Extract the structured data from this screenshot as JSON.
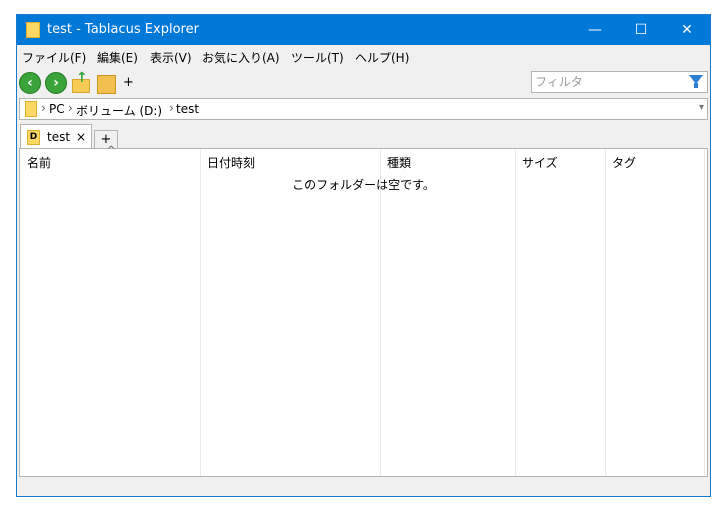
{
  "window": {
    "title": "test - Tablacus Explorer",
    "min_glyph": "—",
    "max_glyph": "☐",
    "close_glyph": "✕"
  },
  "menu": [
    "ファイル(F)",
    "編集(E)",
    "表示(V)",
    "お気に入り(A)",
    "ツール(T)",
    "ヘルプ(H)"
  ],
  "toolbar": {
    "icons": [
      "back-arrow-icon",
      "forward-arrow-icon",
      "up-folder-icon",
      "folder-icon"
    ],
    "add_label": "+",
    "filter_placeholder": "フィルタ"
  },
  "address": {
    "crumbs": [
      "PC",
      "ボリューム (D:)",
      "test"
    ],
    "separator": "›"
  },
  "tabs": [
    {
      "label": "test",
      "icon_letter": "D",
      "close": "×"
    }
  ],
  "new_tab_label": "+",
  "list": {
    "columns": [
      "名前",
      "日付時刻",
      "種類",
      "サイズ",
      "タグ"
    ],
    "sort_indicator": "^",
    "empty_message": "このフォルダーは空です。"
  },
  "colors": {
    "titlebar": "#0078d7",
    "accent_green": "#3aa33a",
    "folder_yellow": "#fcd964"
  }
}
